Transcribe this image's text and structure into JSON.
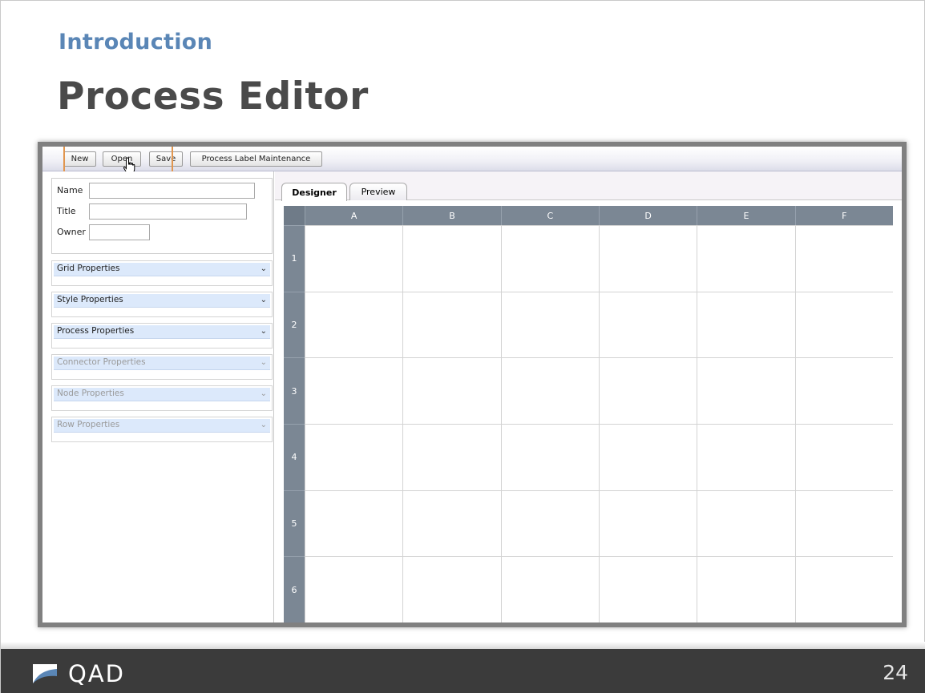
{
  "slide": {
    "section": "Introduction",
    "title": "Process Editor",
    "page_number": "24",
    "brand": "QAD"
  },
  "toolbar": {
    "buttons": [
      {
        "label": "New"
      },
      {
        "label": "Open"
      },
      {
        "label": "Save"
      },
      {
        "label": "Process Label Maintenance"
      }
    ]
  },
  "left_panel": {
    "fields": [
      {
        "label": "Name",
        "value": ""
      },
      {
        "label": "Title",
        "value": ""
      },
      {
        "label": "Owner",
        "value": ""
      }
    ],
    "sections": [
      {
        "label": "Grid Properties",
        "enabled": true
      },
      {
        "label": "Style Properties",
        "enabled": true
      },
      {
        "label": "Process Properties",
        "enabled": true
      },
      {
        "label": "Connector Properties",
        "enabled": false
      },
      {
        "label": "Node Properties",
        "enabled": false
      },
      {
        "label": "Row Properties",
        "enabled": false
      }
    ]
  },
  "tabs": [
    {
      "label": "Designer",
      "active": true
    },
    {
      "label": "Preview",
      "active": false
    }
  ],
  "grid": {
    "columns": [
      "A",
      "B",
      "C",
      "D",
      "E",
      "F"
    ],
    "rows": [
      "1",
      "2",
      "3",
      "4",
      "5",
      "6"
    ]
  },
  "colors": {
    "section_title": "#5a86b6",
    "highlight": "#e1964f",
    "grid_header": "#7b8794",
    "footer": "#3b3b3b"
  }
}
